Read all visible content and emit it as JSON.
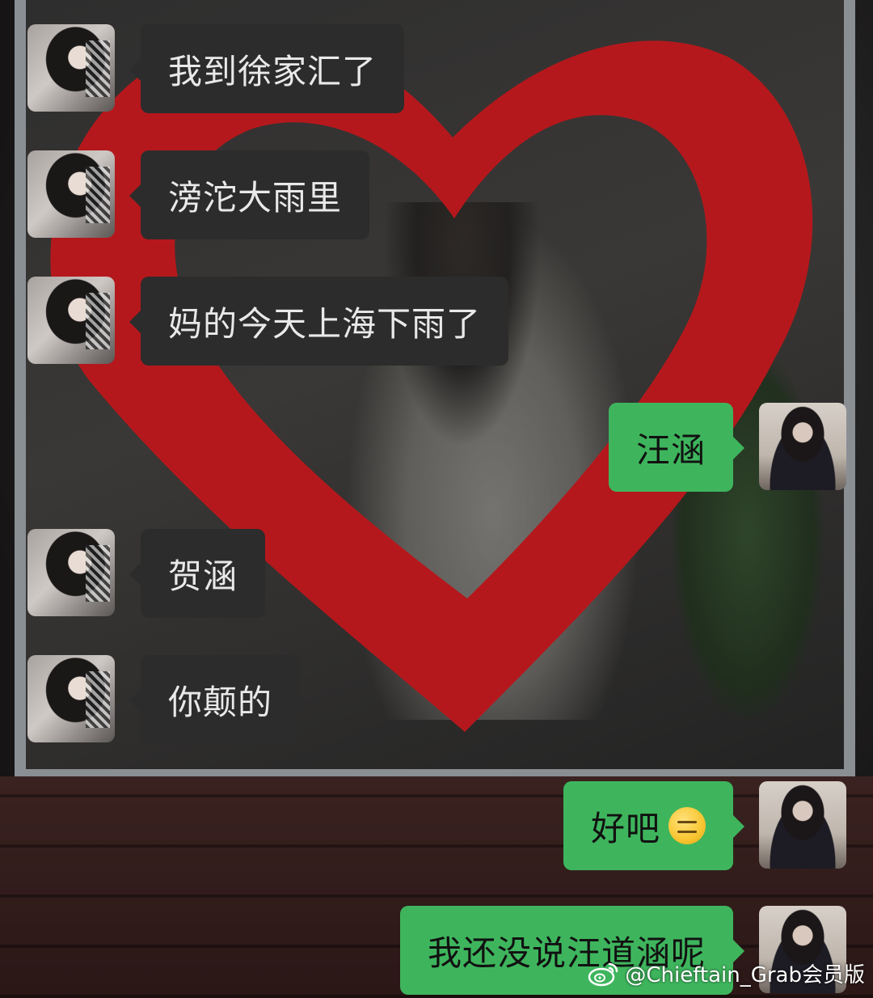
{
  "messages": [
    {
      "side": "incoming",
      "avatar": "female-avatar",
      "text": "我到徐家汇了"
    },
    {
      "side": "incoming",
      "avatar": "female-avatar",
      "text": "滂沱大雨里"
    },
    {
      "side": "incoming",
      "avatar": "female-avatar",
      "text": "妈的今天上海下雨了"
    },
    {
      "side": "outgoing",
      "avatar": "self-avatar",
      "text": "汪涵"
    },
    {
      "side": "incoming",
      "avatar": "female-avatar",
      "text": "贺涵"
    },
    {
      "side": "incoming",
      "avatar": "female-avatar",
      "text": "你颠的"
    },
    {
      "side": "outgoing",
      "avatar": "self-avatar",
      "text": "好吧",
      "emoji": "expressionless-face-emoji"
    },
    {
      "side": "outgoing",
      "avatar": "self-avatar",
      "text": "我还没说汪道涵呢"
    }
  ],
  "watermark": {
    "icon": "weibo-icon",
    "text": "@Chieftain_Grab会员版"
  },
  "colors": {
    "incoming_bubble": "#2c2c2c",
    "outgoing_bubble": "#3eb55d",
    "heart": "#b5181c"
  }
}
